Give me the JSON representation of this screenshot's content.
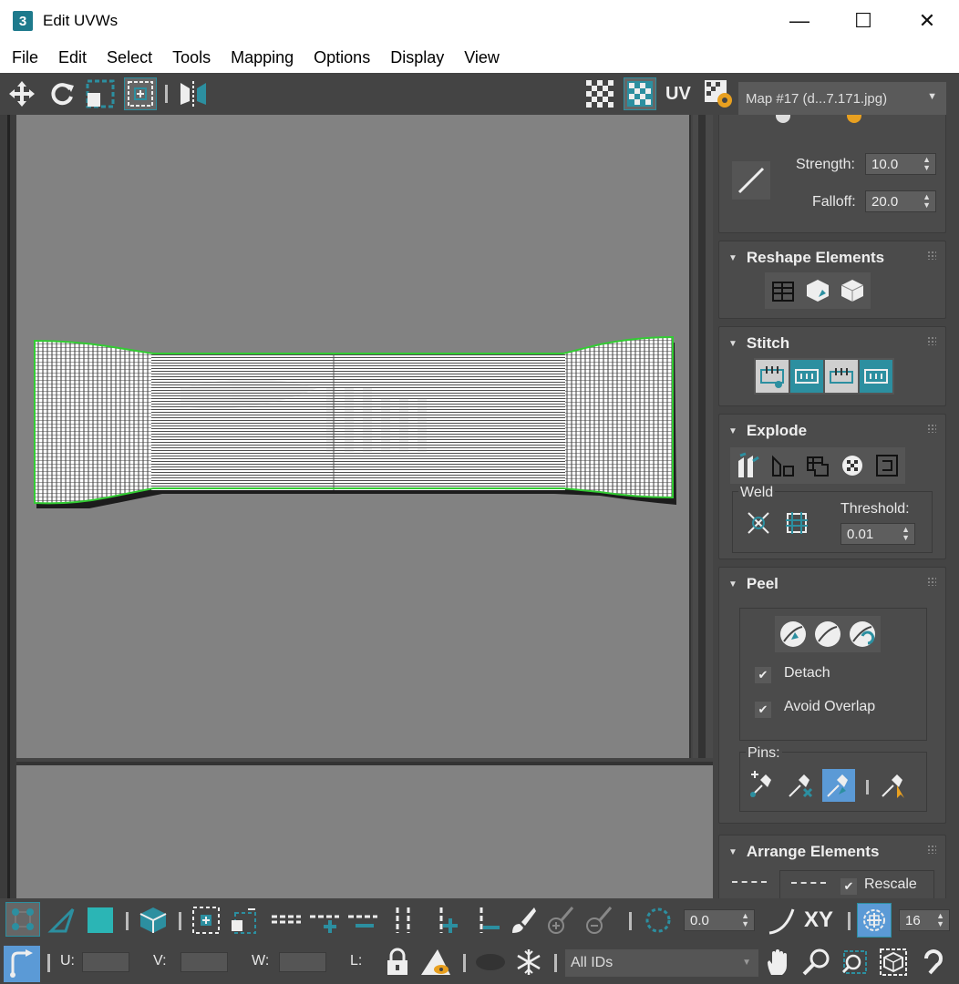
{
  "window": {
    "app_icon_text": "3",
    "title": "Edit UVWs",
    "minimize_glyph": "—",
    "maximize_glyph": "☐",
    "close_glyph": "✕"
  },
  "menu": [
    "File",
    "Edit",
    "Select",
    "Tools",
    "Mapping",
    "Options",
    "Display",
    "View"
  ],
  "top_toolbar": {
    "uv_label": "UV",
    "map_select": "Map #17 (d...7.171.jpg)"
  },
  "soft_selection": {
    "strength_label": "Strength:",
    "strength_value": "10.0",
    "falloff_label": "Falloff:",
    "falloff_value": "20.0"
  },
  "rollouts": {
    "reshape": "Reshape Elements",
    "stitch": "Stitch",
    "explode": "Explode",
    "weld_label": "Weld",
    "threshold_label": "Threshold:",
    "threshold_value": "0.01",
    "peel": "Peel",
    "detach_label": "Detach",
    "avoid_overlap_label": "Avoid Overlap",
    "pins_label": "Pins:",
    "arrange": "Arrange Elements",
    "rescale_label": "Rescale"
  },
  "bottom_toolbar": {
    "angle_value": "0.0",
    "xy_label": "XY",
    "grid_value": "16",
    "u_label": "U:",
    "v_label": "V:",
    "w_label": "W:",
    "l_label": "L:",
    "ids_select": "All IDs"
  },
  "colors": {
    "accent": "#2c8fa0",
    "seam_green": "#33cc33",
    "panel_bg": "#444444",
    "viewport_bg": "#828282"
  }
}
